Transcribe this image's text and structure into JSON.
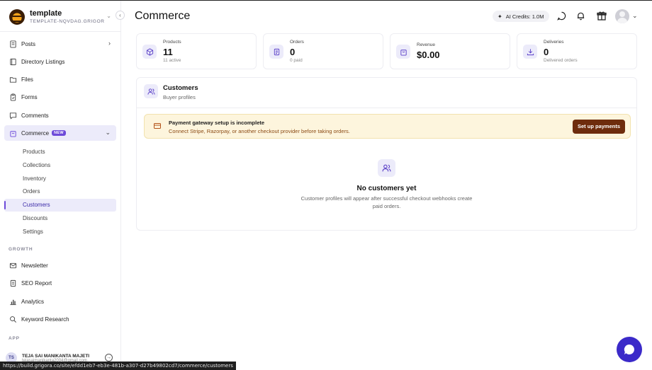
{
  "workspace": {
    "name": "template",
    "slug": "TEMPLATE-NQVDAG.GRIGOR..."
  },
  "sidebar": {
    "items": [
      {
        "label": "Posts",
        "icon": "document-icon"
      },
      {
        "label": "Directory Listings",
        "icon": "book-icon"
      },
      {
        "label": "Files",
        "icon": "folder-icon"
      },
      {
        "label": "Forms",
        "icon": "clipboard-icon"
      },
      {
        "label": "Comments",
        "icon": "comment-icon"
      },
      {
        "label": "Commerce",
        "icon": "bag-icon",
        "badge": "NEW"
      }
    ],
    "commerce_sub": [
      "Products",
      "Collections",
      "Inventory",
      "Orders",
      "Customers",
      "Discounts",
      "Settings"
    ],
    "growth_label": "GROWTH",
    "growth_items": [
      {
        "label": "Newsletter",
        "icon": "mail-icon"
      },
      {
        "label": "SEO Report",
        "icon": "report-icon"
      },
      {
        "label": "Analytics",
        "icon": "bar-chart-icon"
      },
      {
        "label": "Keyword Research",
        "icon": "search-icon"
      }
    ],
    "app_label": "APP",
    "user": {
      "initials": "TS",
      "name": "TEJA SAI MANIKANTA MAJETI",
      "sub": "tejasaimanikanta2004@gmail.com"
    }
  },
  "header": {
    "title": "Commerce",
    "credits": "AI Credits: 1.0M"
  },
  "stats": [
    {
      "label": "Products",
      "value": "11",
      "sub": "11 active",
      "icon": "cube-icon"
    },
    {
      "label": "Orders",
      "value": "0",
      "sub": "0 paid",
      "icon": "receipt-icon"
    },
    {
      "label": "Revenue",
      "value": "$0.00",
      "sub": "",
      "icon": "bag-icon"
    },
    {
      "label": "Deliveries",
      "value": "0",
      "sub": "Delivered orders",
      "icon": "download-icon"
    }
  ],
  "panel": {
    "title": "Customers",
    "subtitle": "Buyer profiles",
    "alert": {
      "title": "Payment gateway setup is incomplete",
      "text": "Connect Stripe, Razorpay, or another checkout provider before taking orders.",
      "button": "Set up payments"
    },
    "empty": {
      "title": "No customers yet",
      "text": "Customer profiles will appear after successful checkout webhooks create paid orders."
    }
  },
  "status_url": "https://build.grigora.co/site/efdd1eb7-eb3e-481b-a307-d27b49802cd7/commerce/customers",
  "colors": {
    "accent": "#6d4ad9",
    "active_bg": "#ecebfa",
    "alert_bg": "#fdf5dd",
    "alert_button": "#6e2c0d",
    "chat_fab": "#3b2ac9"
  }
}
